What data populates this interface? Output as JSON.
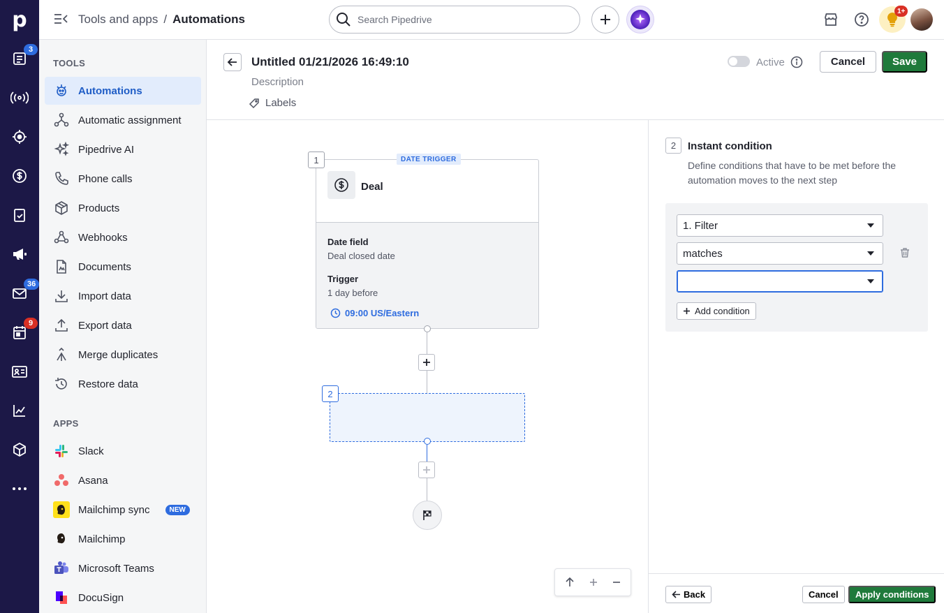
{
  "colors": {
    "rail": "#1c1847",
    "accent": "#2e6cdf",
    "save": "#1f7a3b",
    "active_bg": "#e2ecfc"
  },
  "rail": {
    "logo": "p",
    "items": [
      {
        "icon": "leads-icon",
        "badge": "3"
      },
      {
        "icon": "broadcast-icon"
      },
      {
        "icon": "target-icon"
      },
      {
        "icon": "deals-dollar-icon"
      },
      {
        "icon": "activities-clipboard-icon"
      },
      {
        "icon": "campaigns-megaphone-icon"
      },
      {
        "icon": "mail-icon",
        "badge": "36"
      },
      {
        "icon": "calendar-icon",
        "badge": "9"
      },
      {
        "icon": "contacts-card-icon"
      },
      {
        "icon": "insights-chart-icon"
      },
      {
        "icon": "products-box-icon"
      },
      {
        "icon": "more-icon"
      }
    ]
  },
  "topbar": {
    "breadcrumb_parent": "Tools and apps",
    "breadcrumb_sep": "/",
    "breadcrumb_current": "Automations",
    "search_placeholder": "Search Pipedrive",
    "notif_badge": "1+"
  },
  "sidebar": {
    "tools_heading": "TOOLS",
    "tools": [
      {
        "label": "Automations",
        "icon": "automations-icon",
        "active": true
      },
      {
        "label": "Automatic assignment",
        "icon": "assignment-icon"
      },
      {
        "label": "Pipedrive AI",
        "icon": "sparkle-icon"
      },
      {
        "label": "Phone calls",
        "icon": "phone-icon"
      },
      {
        "label": "Products",
        "icon": "box-icon"
      },
      {
        "label": "Webhooks",
        "icon": "webhook-icon"
      },
      {
        "label": "Documents",
        "icon": "document-icon"
      },
      {
        "label": "Import data",
        "icon": "download-icon"
      },
      {
        "label": "Export data",
        "icon": "upload-icon"
      },
      {
        "label": "Merge duplicates",
        "icon": "merge-icon"
      },
      {
        "label": "Restore data",
        "icon": "restore-icon"
      }
    ],
    "apps_heading": "APPS",
    "apps": [
      {
        "label": "Slack",
        "icon": "slack-icon"
      },
      {
        "label": "Asana",
        "icon": "asana-icon"
      },
      {
        "label": "Mailchimp sync",
        "icon": "mailchimp-sync-icon",
        "badge": "NEW"
      },
      {
        "label": "Mailchimp",
        "icon": "mailchimp-icon"
      },
      {
        "label": "Microsoft Teams",
        "icon": "teams-icon"
      },
      {
        "label": "DocuSign",
        "icon": "docusign-icon"
      }
    ]
  },
  "editor": {
    "title": "Untitled 01/21/2026 16:49:10",
    "description_placeholder": "Description",
    "labels": "Labels",
    "active_label": "Active",
    "cancel": "Cancel",
    "save": "Save"
  },
  "canvas": {
    "trigger_step": "1",
    "trigger_tag": "DATE TRIGGER",
    "trigger_entity": "Deal",
    "date_field_label": "Date field",
    "date_field_value": "Deal closed date",
    "trigger_label": "Trigger",
    "trigger_value": "1 day before",
    "trigger_time": "09:00 US/Eastern",
    "placeholder_step": "2"
  },
  "panel": {
    "step": "2",
    "title": "Instant condition",
    "description": "Define conditions that have to be met before the automation moves to the next step",
    "filter_value": "1. Filter",
    "operator_value": "matches",
    "value_value": "",
    "add_condition": "Add condition",
    "back": "Back",
    "cancel": "Cancel",
    "apply": "Apply conditions"
  }
}
